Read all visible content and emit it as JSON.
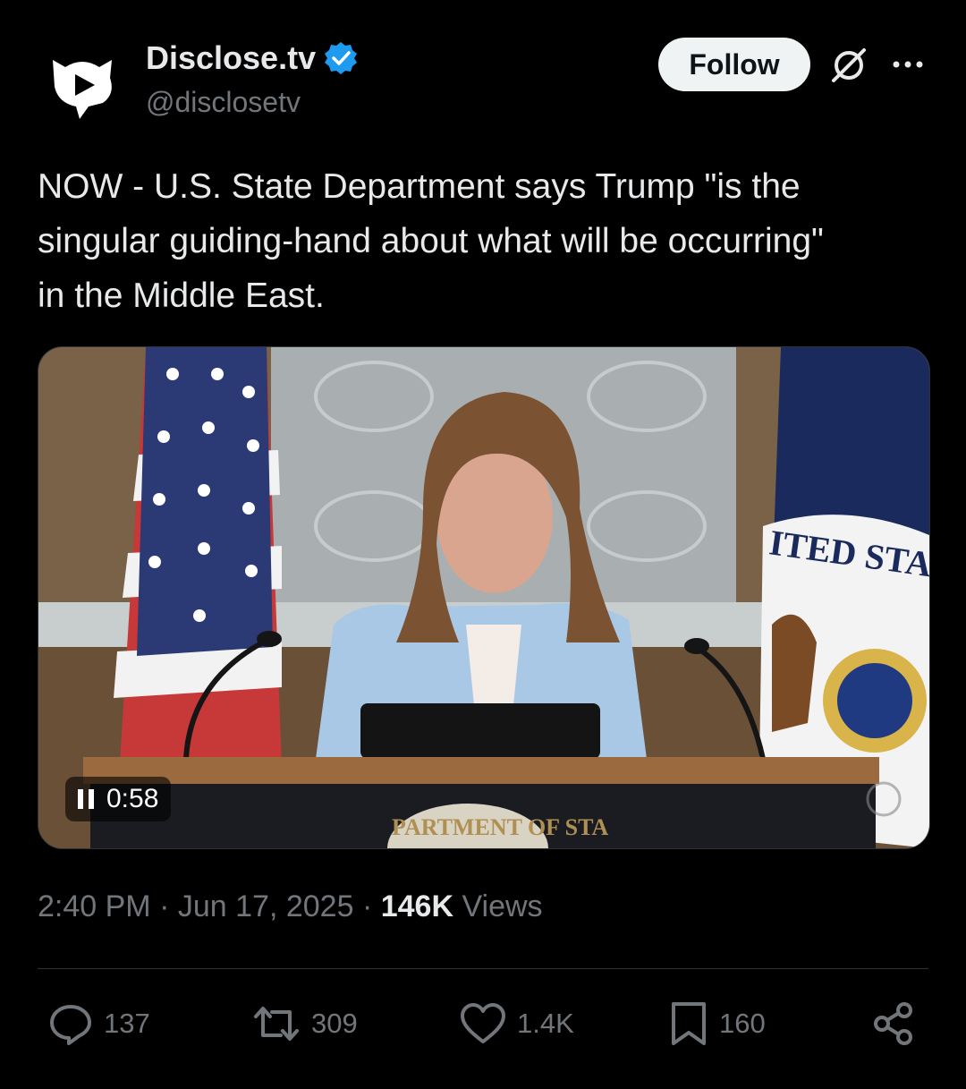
{
  "account": {
    "display_name": "Disclose.tv",
    "handle": "@disclosetv",
    "verified": true,
    "avatar_icon": "play-speech-bubble-icon"
  },
  "header": {
    "follow_label": "Follow",
    "grok_icon": "grok-icon",
    "more_icon": "more-dots-icon"
  },
  "tweet": {
    "text": "NOW - U.S. State Department says Trump \"is the\nsingular guiding-hand about what will be occurring\"\nin the Middle East."
  },
  "media": {
    "type": "video",
    "timestamp": "0:58",
    "seal_top_text": "ITED STAT",
    "podium_text": "PARTMENT OF STA"
  },
  "meta": {
    "time": "2:40 PM",
    "separator": "·",
    "date": "Jun 17, 2025",
    "views_count": "146K",
    "views_label": "Views"
  },
  "actions": {
    "replies": "137",
    "reposts": "309",
    "likes": "1.4K",
    "bookmarks": "160"
  },
  "colors": {
    "background": "#000000",
    "text_primary": "#e7e9ea",
    "text_secondary": "#71767b",
    "verified_blue": "#1d9bf0",
    "follow_bg": "#eff3f4"
  }
}
